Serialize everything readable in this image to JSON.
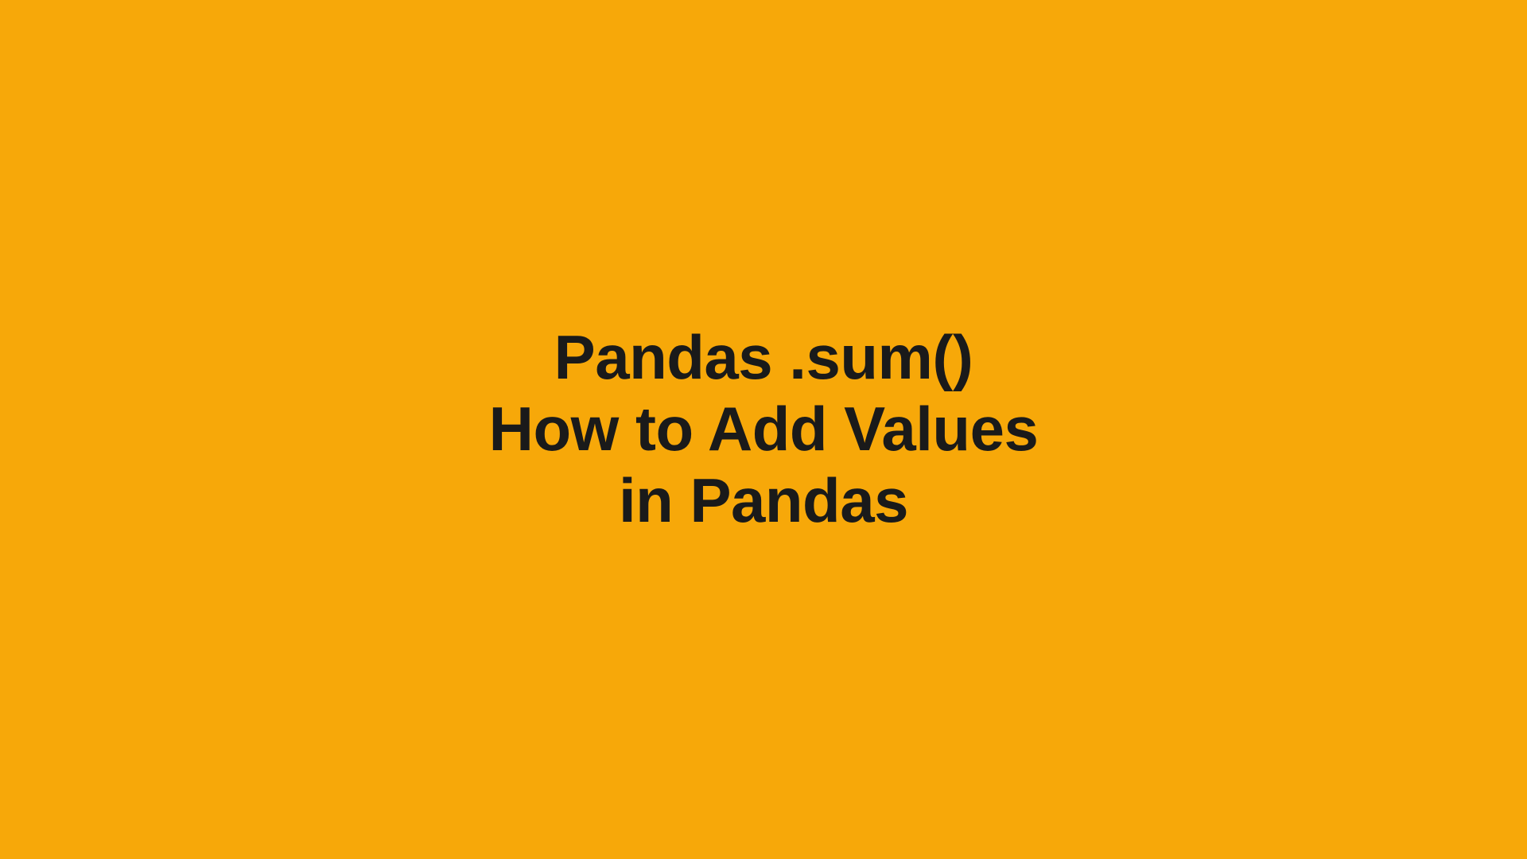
{
  "title": {
    "line1": "Pandas .sum()",
    "line2": "How to Add Values",
    "line3": "in Pandas"
  }
}
